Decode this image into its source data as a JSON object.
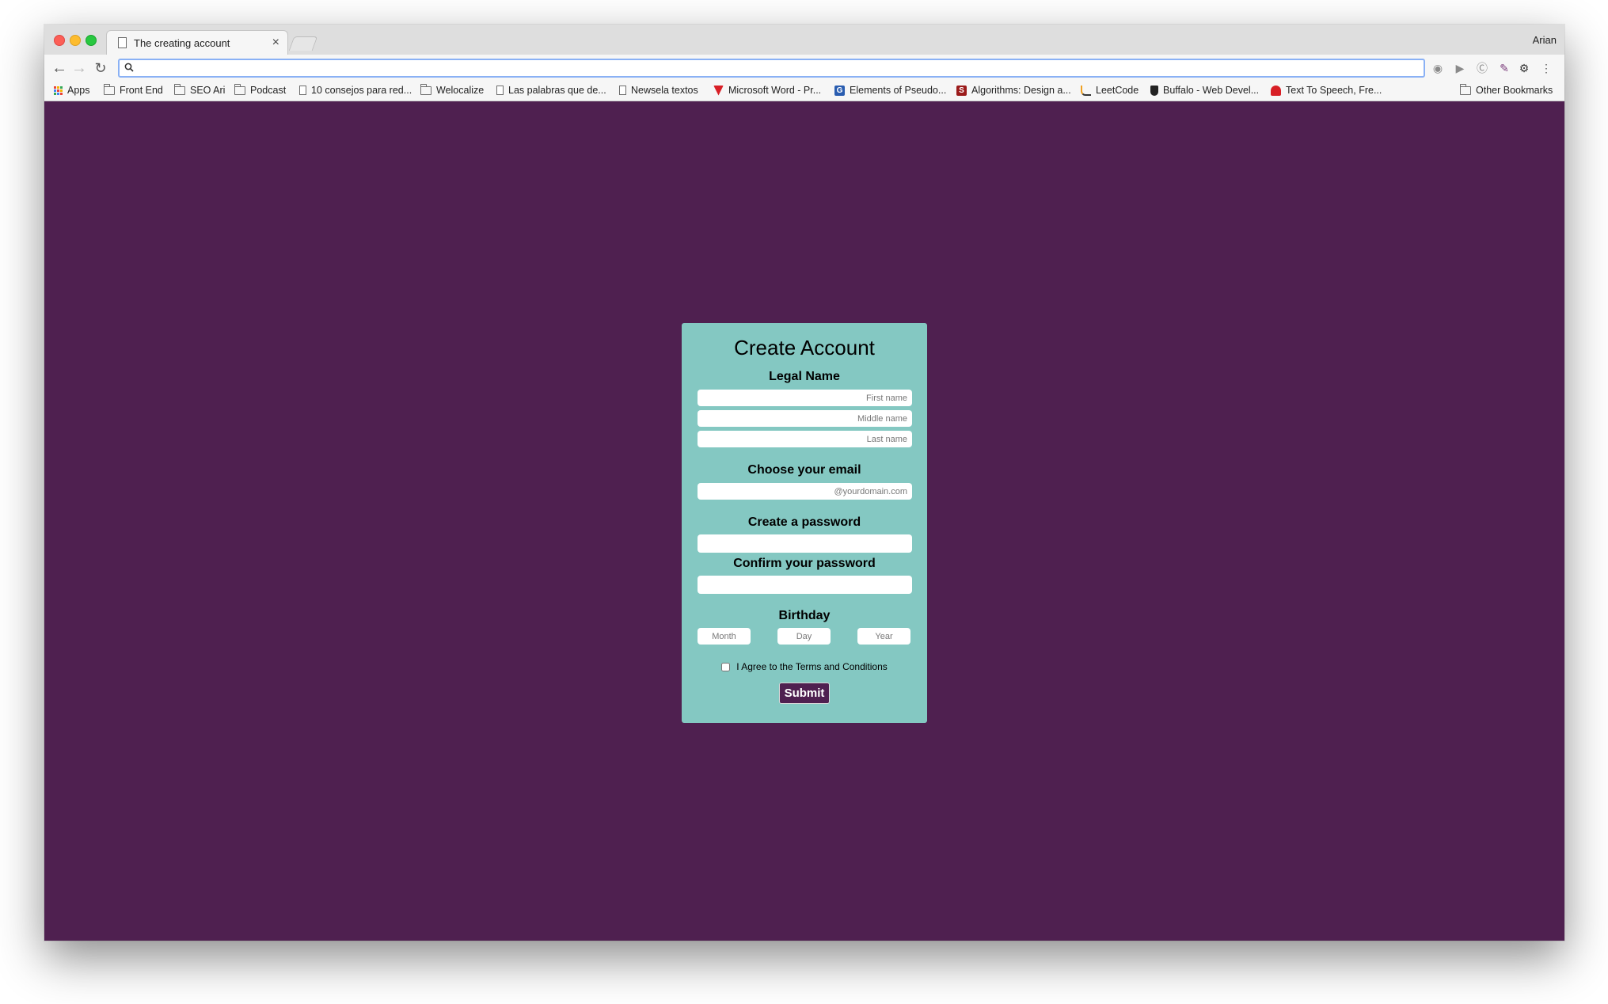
{
  "browser": {
    "tab_title": "The creating account",
    "tab_close": "×",
    "profile_name": "Arian",
    "address_value": "",
    "bookmarks": [
      {
        "label": "Apps",
        "icon": "apps-grid-icon"
      },
      {
        "label": "Front End",
        "icon": "folder-icon"
      },
      {
        "label": "SEO Ari",
        "icon": "folder-icon"
      },
      {
        "label": "Podcast",
        "icon": "folder-icon"
      },
      {
        "label": "10 consejos para red...",
        "icon": "page-icon"
      },
      {
        "label": "Welocalize",
        "icon": "folder-icon"
      },
      {
        "label": "Las palabras que de...",
        "icon": "page-icon"
      },
      {
        "label": "Newsela textos",
        "icon": "page-icon"
      },
      {
        "label": "Microsoft Word - Pr...",
        "icon": "pdf-icon"
      },
      {
        "label": "Elements of Pseudo...",
        "icon": "g-icon"
      },
      {
        "label": "Algorithms: Design a...",
        "icon": "s-icon"
      },
      {
        "label": "LeetCode",
        "icon": "leetcode-icon"
      },
      {
        "label": "Buffalo - Web Devel...",
        "icon": "shield-icon"
      },
      {
        "label": "Text To Speech, Fre...",
        "icon": "tts-icon"
      }
    ],
    "other_bookmarks": "Other Bookmarks"
  },
  "form": {
    "title": "Create Account",
    "legal_name_label": "Legal Name",
    "first_name_placeholder": "First name",
    "middle_name_placeholder": "Middle name",
    "last_name_placeholder": "Last name",
    "email_label": "Choose your email",
    "email_placeholder": "@yourdomain.com",
    "password_label": "Create a password",
    "confirm_password_label": "Confirm your password",
    "birthday_label": "Birthday",
    "month_placeholder": "Month",
    "day_placeholder": "Day",
    "year_placeholder": "Year",
    "terms_label": "I Agree to the Terms and Conditions",
    "terms_checked": false,
    "submit_label": "Submit"
  },
  "colors": {
    "page_background": "#4f2050",
    "card_background": "#84c8c2",
    "submit_background": "#4f2050"
  }
}
